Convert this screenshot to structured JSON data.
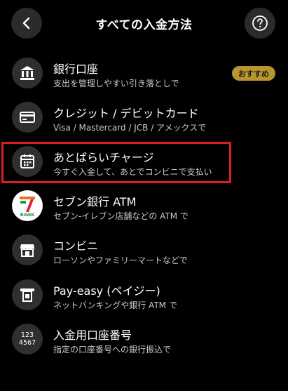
{
  "header": {
    "title": "すべての入金方法"
  },
  "badge": {
    "label": "おすすめ"
  },
  "items": [
    {
      "title": "銀行口座",
      "subtitle": "支出を管理しやすい引き落としで"
    },
    {
      "title": "クレジット / デビットカード",
      "subtitle": "Visa / Mastercard / JCB / アメックスで"
    },
    {
      "title": "あとばらいチャージ",
      "subtitle": "今すぐ入金して、あとでコンビニで支払い"
    },
    {
      "title": "セブン銀行 ATM",
      "subtitle": "セブン-イレブン店舗などの ATM で"
    },
    {
      "title": "コンビニ",
      "subtitle": "ローソンやファミリーマートなどで"
    },
    {
      "title": "Pay-easy (ペイジー)",
      "subtitle": "ネットバンキングや銀行 ATM で"
    },
    {
      "title": "入金用口座番号",
      "subtitle": "指定の口座番号への銀行振込で"
    }
  ],
  "icons": {
    "bank": "bank-icon",
    "card": "credit-card-icon",
    "calendar": "calendar-icon",
    "seven": "seven-bank-logo",
    "store": "store-icon",
    "atm": "atm-icon",
    "number": "account-number-icon",
    "number_text_1": "123",
    "number_text_2": "4567",
    "seven_logo_text": "BANK"
  },
  "colors": {
    "background": "#000000",
    "icon_bg": "#2f2f2f",
    "badge": "#b8952e",
    "highlight": "#e01c22"
  }
}
